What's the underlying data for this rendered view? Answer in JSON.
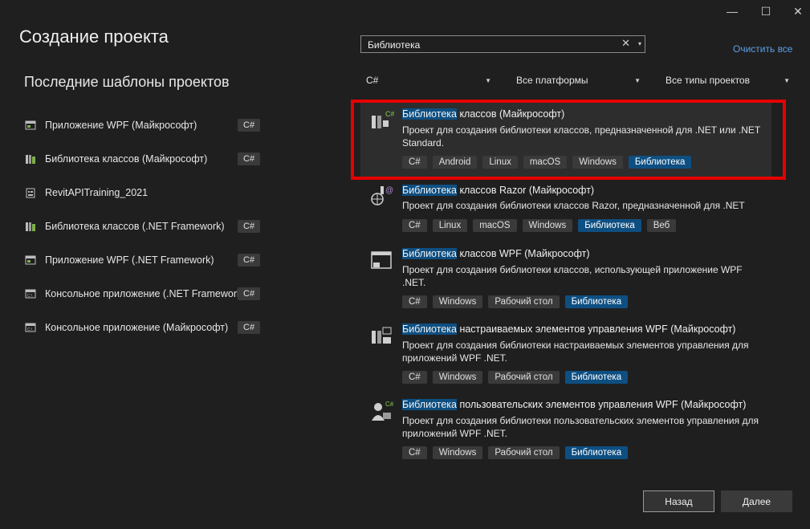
{
  "window_controls": {
    "minimize": "—",
    "maximize": "☐",
    "close": "✕"
  },
  "page_title": "Создание проекта",
  "recent": {
    "title": "Последние шаблоны проектов",
    "items": [
      {
        "label": "Приложение WPF (Майкрософт)",
        "tag": "C#",
        "icon": "wpf-app-icon"
      },
      {
        "label": "Библиотека классов (Майкрософт)",
        "tag": "C#",
        "icon": "class-library-icon"
      },
      {
        "label": "RevitAPITraining_2021",
        "tag": "",
        "icon": "project-icon"
      },
      {
        "label": "Библиотека классов (.NET Framework)",
        "tag": "C#",
        "icon": "class-library-icon"
      },
      {
        "label": "Приложение WPF (.NET Framework)",
        "tag": "C#",
        "icon": "wpf-app-icon"
      },
      {
        "label": "Консольное приложение (.NET Framework)",
        "tag": "C#",
        "icon": "console-app-icon"
      },
      {
        "label": "Консольное приложение (Майкрософт)",
        "tag": "C#",
        "icon": "console-app-icon"
      }
    ]
  },
  "search": {
    "value": "Библиотека",
    "clear_icon": "✕",
    "dropdown_icon": "▾"
  },
  "clear_all": "Очистить все",
  "filters": {
    "language": "C#",
    "platform": "Все платформы",
    "project_type": "Все типы проектов"
  },
  "templates": [
    {
      "name_highlight": "Библиотека",
      "name_rest": " классов (Майкрософт)",
      "desc": "Проект для создания библиотеки классов, предназначенной для .NET или .NET Standard.",
      "tags": [
        "C#",
        "Android",
        "Linux",
        "macOS",
        "Windows",
        "Библиотека"
      ],
      "highlight_tag": "Библиотека",
      "icon": "class-library-icon"
    },
    {
      "name_highlight": "Библиотека",
      "name_rest": " классов Razor (Майкрософт)",
      "desc": "Проект для создания библиотеки классов Razor, предназначенной для .NET",
      "tags": [
        "C#",
        "Linux",
        "macOS",
        "Windows",
        "Библиотека",
        "Веб"
      ],
      "highlight_tag": "Библиотека",
      "icon": "razor-library-icon"
    },
    {
      "name_highlight": "Библиотека",
      "name_rest": " классов WPF (Майкрософт)",
      "desc": "Проект для создания библиотеки классов, использующей приложение WPF .NET.",
      "tags": [
        "C#",
        "Windows",
        "Рабочий стол",
        "Библиотека"
      ],
      "highlight_tag": "Библиотека",
      "icon": "wpf-library-icon"
    },
    {
      "name_highlight": "Библиотека",
      "name_rest": " настраиваемых элементов управления WPF (Майкрософт)",
      "desc": "Проект для создания библиотеки настраиваемых элементов управления для приложений WPF .NET.",
      "tags": [
        "C#",
        "Windows",
        "Рабочий стол",
        "Библиотека"
      ],
      "highlight_tag": "Библиотека",
      "icon": "wpf-custom-control-library-icon"
    },
    {
      "name_highlight": "Библиотека",
      "name_rest": " пользовательских элементов управления WPF (Майкрософт)",
      "desc": "Проект для создания библиотеки пользовательских элементов управления для приложений WPF .NET.",
      "tags": [
        "C#",
        "Windows",
        "Рабочий стол",
        "Библиотека"
      ],
      "highlight_tag": "Библиотека",
      "icon": "wpf-user-control-library-icon"
    }
  ],
  "buttons": {
    "back": "Назад",
    "next": "Далее"
  },
  "colors": {
    "accent": "#5aa0e8",
    "highlight": "#0e4f82",
    "selection_border": "#e60000"
  }
}
